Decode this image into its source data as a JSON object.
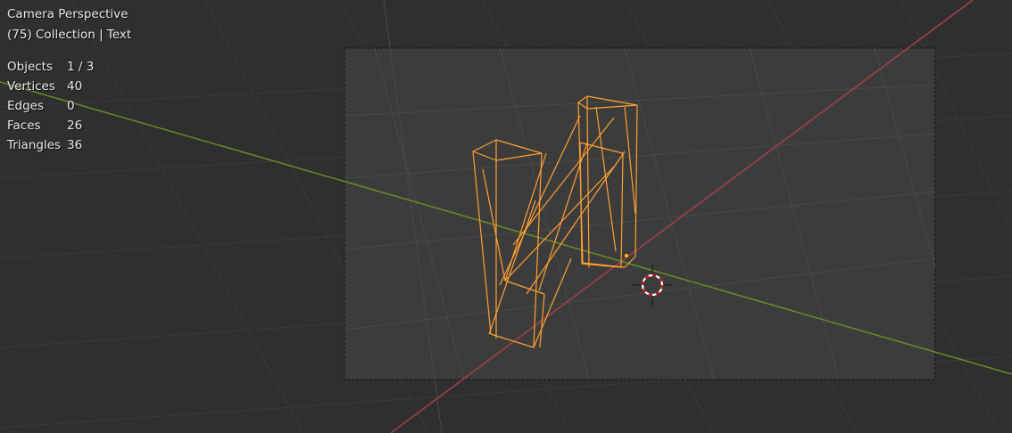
{
  "header": {
    "view_name": "Camera Perspective",
    "context": "(75) Collection | Text"
  },
  "stats": [
    {
      "label": "Objects",
      "value": "1 / 3"
    },
    {
      "label": "Vertices",
      "value": "40"
    },
    {
      "label": "Edges",
      "value": "0"
    },
    {
      "label": "Faces",
      "value": "26"
    },
    {
      "label": "Triangles",
      "value": "36"
    }
  ],
  "colors": {
    "background": "#2f2f2f",
    "camera_frame": "#3c3c3c",
    "x_axis": "#a54048",
    "y_axis": "#6a8a2a",
    "selection": "#ffa032",
    "grid": "#393939"
  },
  "icons": [
    "3d-cursor-icon",
    "origin-dot-icon"
  ]
}
